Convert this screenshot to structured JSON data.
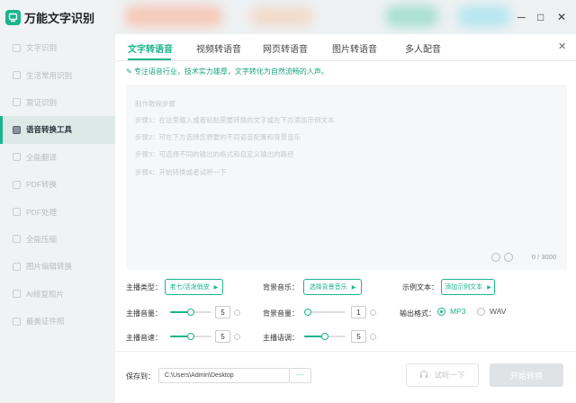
{
  "app": {
    "title": "万能文字识别",
    "accent": "#19b48c"
  },
  "window": {
    "minimize": "─",
    "maximize": "□",
    "close": "✕"
  },
  "sidebar": {
    "items": [
      {
        "label": "文字识别",
        "icon": "text-scan-icon"
      },
      {
        "label": "生活常用识别",
        "icon": "scan-icon"
      },
      {
        "label": "票证识别",
        "icon": "ticket-icon"
      },
      {
        "label": "语音转换工具",
        "icon": "audio-tool-icon",
        "active": true
      },
      {
        "label": "全能翻译",
        "icon": "translate-icon"
      },
      {
        "label": "PDF转换",
        "icon": "pdf-convert-icon"
      },
      {
        "label": "PDF处理",
        "icon": "pdf-process-icon"
      },
      {
        "label": "全能压缩",
        "icon": "compress-icon"
      },
      {
        "label": "图片编辑转换",
        "icon": "image-edit-icon"
      },
      {
        "label": "AI修复照片",
        "icon": "ai-photo-icon"
      },
      {
        "label": "最美证件照",
        "icon": "id-photo-icon"
      }
    ]
  },
  "tabs": [
    {
      "label": "文字转语音",
      "active": true
    },
    {
      "label": "视频转语音"
    },
    {
      "label": "网页转语音"
    },
    {
      "label": "图片转语音"
    },
    {
      "label": "多人配音"
    }
  ],
  "tab_close": "✕",
  "notice": "专注语音行业，技术实力雄厚，文字转化为自然流畅的人声。",
  "editor": {
    "lines": [
      "制作教程步骤",
      "步骤1：在这里输入或者粘贴需要转换的文字或在下方添加示例文本",
      "步骤2：可在下方选择您想要的不同语音配置和背景音乐",
      "步骤3：可选择不同的输出的格式和自定义输出的路径",
      "步骤4：开始转换或者试听一下"
    ],
    "count": "0 / 3000"
  },
  "settings": {
    "anchor_type_label": "主播类型：",
    "anchor_type_btn": "老七/活泼俏皮",
    "bgm_label": "背景音乐：",
    "bgm_btn": "选择背景音乐",
    "sample_label": "示例文本：",
    "sample_btn": "添加示例文本",
    "anchor_volume_label": "主播音量：",
    "anchor_volume_value": "5",
    "anchor_volume_level": 0.5,
    "bgm_volume_label": "背景音量：",
    "bgm_volume_value": "1",
    "bgm_volume_level": 0.0,
    "output_format_label": "输出格式：",
    "format_mp3": "MP3",
    "format_wav": "WAV",
    "anchor_speed_label": "主播音速：",
    "anchor_speed_value": "5",
    "anchor_speed_level": 0.5,
    "anchor_tone_label": "主播语调：",
    "anchor_tone_value": "5",
    "anchor_tone_level": 0.5
  },
  "footer": {
    "save_label": "保存到：",
    "save_path": "C:\\Users\\Admin\\Desktop",
    "browse": "···",
    "listen": "试听一下",
    "start": "开始转换"
  }
}
